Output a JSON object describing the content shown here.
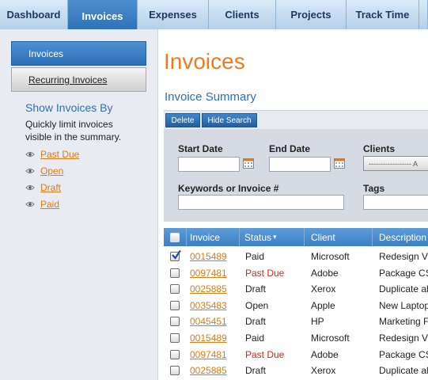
{
  "nav": {
    "tabs": [
      {
        "label": "Dashboard"
      },
      {
        "label": "Invoices"
      },
      {
        "label": "Expenses"
      },
      {
        "label": "Clients"
      },
      {
        "label": "Projects"
      },
      {
        "label": "Track Time"
      }
    ],
    "active": "Invoices"
  },
  "sidebar": {
    "items": [
      {
        "label": "Invoices"
      },
      {
        "label": "Recurring Invoices"
      }
    ],
    "show_by_title": "Show Invoices By",
    "show_by_desc": "Quickly limit invoices visible in the summary.",
    "filters": [
      "Past Due",
      "Open",
      "Draft",
      "Paid"
    ]
  },
  "main": {
    "title": "Invoices",
    "summary_title": "Invoice Summary",
    "buttons": {
      "delete": "Delete",
      "hide_search": "Hide Search"
    },
    "search": {
      "start_date_label": "Start Date",
      "end_date_label": "End Date",
      "clients_label": "Clients",
      "clients_value": "------------------ A",
      "keywords_label": "Keywords or Invoice #",
      "tags_label": "Tags",
      "start_date_value": "",
      "end_date_value": "",
      "keywords_value": "",
      "tags_value": ""
    },
    "table": {
      "headers": [
        "Invoice",
        "Status",
        "Client",
        "Description"
      ],
      "sort_indicator": "▾",
      "rows": [
        {
          "checked": true,
          "invoice": "0015489",
          "status": "Paid",
          "client": "Microsoft",
          "description": "Redesign V"
        },
        {
          "checked": false,
          "invoice": "0097481",
          "status": "Past Due",
          "client": "Adobe",
          "description": "Package CS"
        },
        {
          "checked": false,
          "invoice": "0025885",
          "status": "Draft",
          "client": "Xerox",
          "description": "Duplicate al"
        },
        {
          "checked": false,
          "invoice": "0035483",
          "status": "Open",
          "client": "Apple",
          "description": "New Laptop"
        },
        {
          "checked": false,
          "invoice": "0045451",
          "status": "Draft",
          "client": "HP",
          "description": "Marketing F"
        },
        {
          "checked": false,
          "invoice": "0015489",
          "status": "Paid",
          "client": "Microsoft",
          "description": "Redesign V"
        },
        {
          "checked": false,
          "invoice": "0097481",
          "status": "Past Due",
          "client": "Adobe",
          "description": "Package CS"
        },
        {
          "checked": false,
          "invoice": "0025885",
          "status": "Draft",
          "client": "Xerox",
          "description": "Duplicate al"
        }
      ]
    }
  },
  "colors": {
    "accent_orange": "#ef7a1f",
    "link_orange": "#e07a12",
    "title_blue": "#2f6fb6",
    "past_due_red": "#d0261c"
  }
}
